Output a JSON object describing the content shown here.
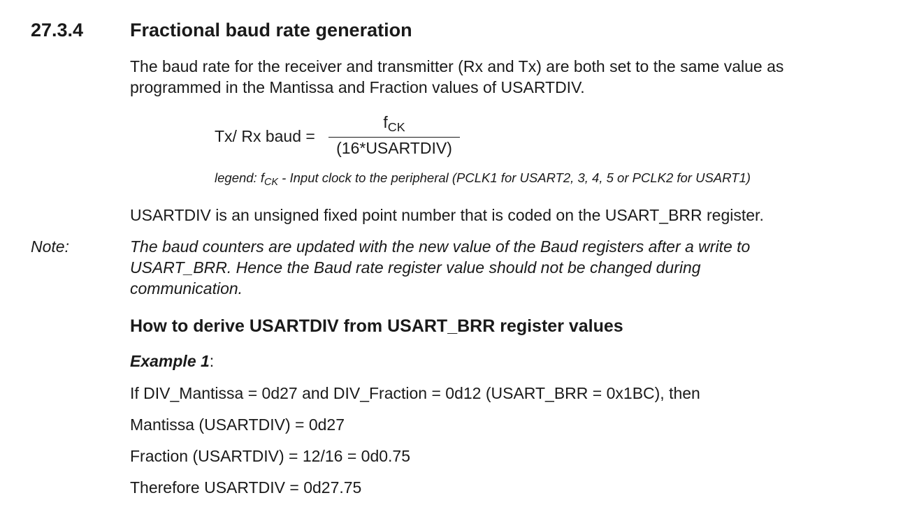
{
  "section": {
    "number": "27.3.4",
    "title": "Fractional baud rate generation"
  },
  "intro": {
    "line1": "The baud rate for the receiver and transmitter (Rx and Tx) are both set to the same value as",
    "line2": "programmed in the Mantissa and Fraction values of USARTDIV."
  },
  "formula": {
    "label": "Tx/ Rx baud =",
    "numerator_f": "f",
    "numerator_sub": "CK",
    "denominator": "(16*USARTDIV)"
  },
  "legend": {
    "prefix": "legend: f",
    "sub": "CK",
    "text": " - Input clock to the peripheral (PCLK1 for USART2, 3, 4, 5 or PCLK2 for USART1)"
  },
  "usartdiv_desc": "USARTDIV is an unsigned fixed point number that is coded on the USART_BRR register.",
  "note": {
    "label": "Note:",
    "line1": "The baud counters are updated with the new value of the Baud registers after a write to",
    "line2": "USART_BRR. Hence the Baud rate register value should not be changed during",
    "line3": "communication."
  },
  "subheading": "How to derive USARTDIV from USART_BRR register values",
  "example": {
    "label": "Example 1",
    "colon": ":",
    "lines": [
      "If DIV_Mantissa = 0d27 and DIV_Fraction = 0d12 (USART_BRR = 0x1BC), then",
      "Mantissa (USARTDIV) = 0d27",
      "Fraction (USARTDIV) = 12/16 = 0d0.75",
      "Therefore USARTDIV = 0d27.75"
    ]
  }
}
